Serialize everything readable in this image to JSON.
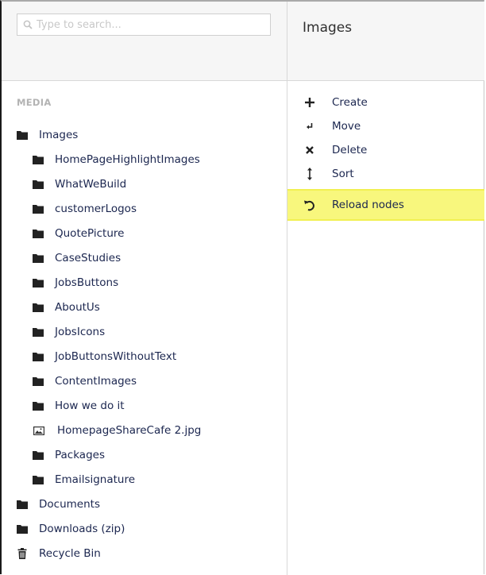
{
  "search": {
    "placeholder": "Type to search...",
    "value": "",
    "icon": "search-icon"
  },
  "right_panel": {
    "title": "Images",
    "actions": [
      {
        "label": "Create",
        "icon": "plus-icon"
      },
      {
        "label": "Move",
        "icon": "move-arrow-icon"
      },
      {
        "label": "Delete",
        "icon": "x-icon"
      },
      {
        "label": "Sort",
        "icon": "sort-arrows-icon"
      },
      {
        "label": "Reload nodes",
        "icon": "reload-icon",
        "highlighted": true
      }
    ],
    "highlight_color": "#f8f77d"
  },
  "tree": {
    "section_label": "MEDIA",
    "root": {
      "label": "Images",
      "icon": "folder-icon"
    },
    "children": [
      {
        "label": "HomePageHighlightImages",
        "icon": "folder-icon"
      },
      {
        "label": "WhatWeBuild",
        "icon": "folder-icon"
      },
      {
        "label": "customerLogos",
        "icon": "folder-icon"
      },
      {
        "label": "QuotePicture",
        "icon": "folder-icon"
      },
      {
        "label": "CaseStudies",
        "icon": "folder-icon"
      },
      {
        "label": "JobsButtons",
        "icon": "folder-icon"
      },
      {
        "label": "AboutUs",
        "icon": "folder-icon"
      },
      {
        "label": "JobsIcons",
        "icon": "folder-icon"
      },
      {
        "label": "JobButtonsWithoutText",
        "icon": "folder-icon"
      },
      {
        "label": "ContentImages",
        "icon": "folder-icon"
      },
      {
        "label": "How we do it",
        "icon": "folder-icon"
      },
      {
        "label": "HomepageShareCafe 2.jpg",
        "icon": "image-icon"
      },
      {
        "label": "Packages",
        "icon": "folder-icon"
      },
      {
        "label": "Emailsignature",
        "icon": "folder-icon"
      }
    ],
    "siblings": [
      {
        "label": "Documents",
        "icon": "folder-icon"
      },
      {
        "label": "Downloads (zip)",
        "icon": "folder-icon"
      },
      {
        "label": "Recycle Bin",
        "icon": "trash-icon"
      }
    ]
  }
}
